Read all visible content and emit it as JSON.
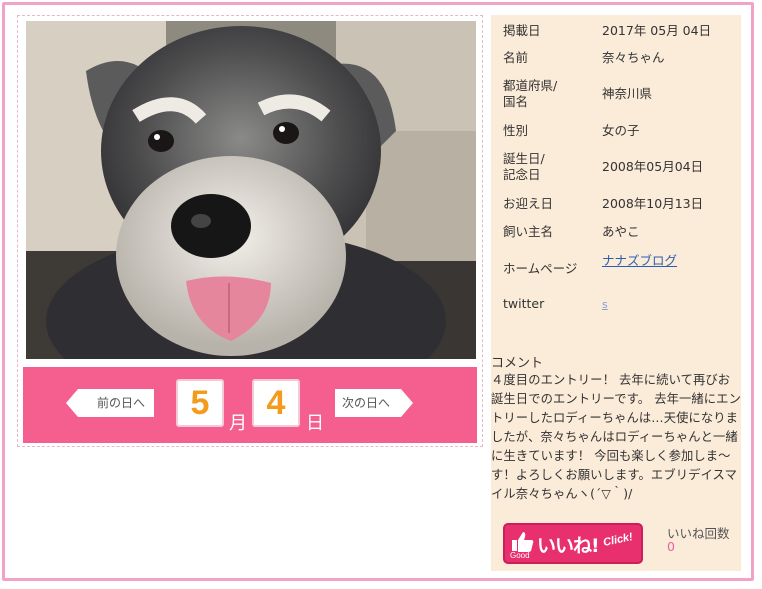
{
  "navigation": {
    "prev_label": "前の日へ",
    "next_label": "次の日へ",
    "month": "5",
    "month_unit": "月",
    "day": "4",
    "day_unit": "日"
  },
  "photo": {
    "subject": "schnauzer-dog-photo"
  },
  "profile": {
    "rows": [
      {
        "label": "掲載日",
        "value": "2017年 05月 04日"
      },
      {
        "label": "名前",
        "value": "奈々ちゃん"
      },
      {
        "label": "都道府県/\n国名",
        "value": "神奈川県"
      },
      {
        "label": "性別",
        "value": "女の子"
      },
      {
        "label": "誕生日/\n記念日",
        "value": "2008年05月04日"
      },
      {
        "label": "お迎え日",
        "value": "2008年10月13日"
      },
      {
        "label": "飼い主名",
        "value": "あやこ"
      },
      {
        "label": "ホームページ",
        "value": "ナナズブログ"
      },
      {
        "label": "twitter",
        "value": "s"
      }
    ]
  },
  "comment": {
    "label": "コメント",
    "text": "４度目のエントリー！ 去年に続いて再びお誕生日でのエントリーです。 去年一緒にエントリーしたロディーちゃんは…天使になりましたが、奈々ちゃんはロディーちゃんと一緒に生きています！ 今回も楽しく参加しま～す！よろしくお願いします。エブリデイスマイル奈々ちゃんヽ(´▽｀)/"
  },
  "like": {
    "good_label": "Good",
    "button_label": "いいね!",
    "click_label": "Click!",
    "count_label": "いいね回数",
    "count_value": "0"
  },
  "colors": {
    "frame": "#f0a3c7",
    "date_bar": "#f45f90",
    "number": "#f39b1d",
    "panel": "#fbebd9",
    "like_button": "#e8306e"
  }
}
